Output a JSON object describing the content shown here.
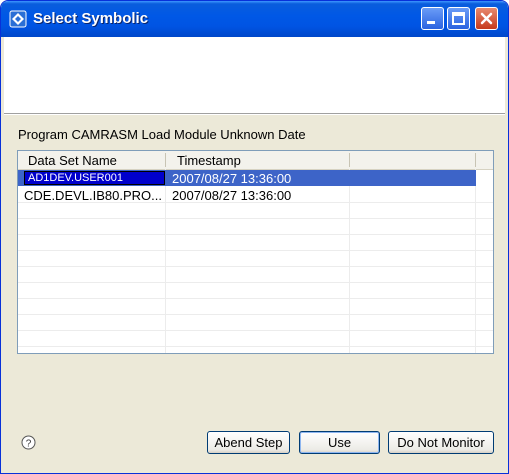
{
  "window": {
    "title": "Select Symbolic",
    "controls": {
      "minimize": "minimize",
      "maximize": "maximize",
      "close": "close"
    }
  },
  "main": {
    "description": "Program CAMRASM Load Module Unknown Date",
    "table": {
      "columns": [
        "Data Set Name",
        "Timestamp",
        ""
      ],
      "rows": [
        {
          "name": "AD1DEV.USER001",
          "timestamp": "2007/08/27 13:36:00",
          "selected": true
        },
        {
          "name": "CDE.DEVL.IB80.PRO...",
          "timestamp": "2007/08/27 13:36:00",
          "selected": false
        }
      ]
    }
  },
  "footer": {
    "buttons": {
      "abend_step": "Abend Step",
      "use": "Use",
      "do_not_monitor": "Do Not Monitor"
    }
  },
  "icons": {
    "app": "symbolic-app-icon",
    "help": "help-icon"
  },
  "colors": {
    "selection": "#3d64c8",
    "edit_box": "#0000cc",
    "titlebar": "#0054e3"
  }
}
